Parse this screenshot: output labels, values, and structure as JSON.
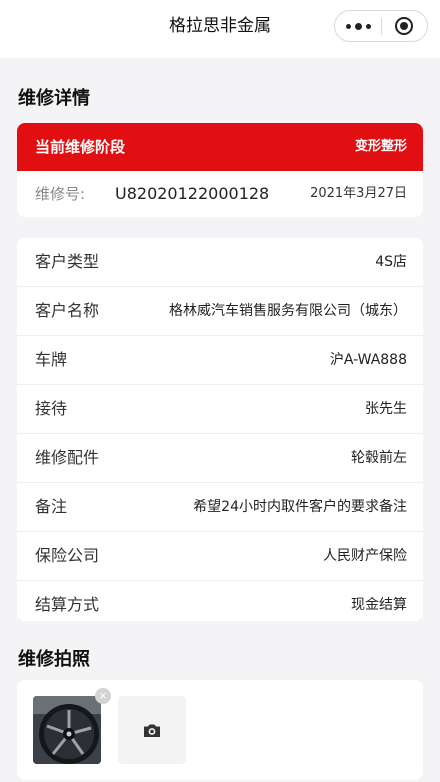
{
  "header": {
    "title": "格拉思非金属"
  },
  "repair_details": {
    "section_title": "维修详情",
    "stage_label": "当前维修阶段",
    "stage_value": "变形整形",
    "order_label": "维修号:",
    "order_number": "U82020122000128",
    "order_date": "2021年3月27日"
  },
  "info_rows": [
    {
      "key": "客户类型",
      "value": "4S店"
    },
    {
      "key": "客户名称",
      "value": "格林威汽车销售服务有限公司（城东）"
    },
    {
      "key": "车牌",
      "value": "沪A-WA888"
    },
    {
      "key": "接待",
      "value": "张先生"
    },
    {
      "key": "维修配件",
      "value": "轮毂前左"
    },
    {
      "key": "备注",
      "value": "希望24小时内取件客户的要求备注"
    },
    {
      "key": "保险公司",
      "value": "人民财产保险"
    },
    {
      "key": "结算方式",
      "value": "现金结算"
    }
  ],
  "photos": {
    "section_title": "维修拍照",
    "delete_symbol": "×",
    "icons": {
      "camera": "camera-icon",
      "delete": "close-icon"
    }
  },
  "colors": {
    "accent": "#e10e12",
    "background": "#f4f4f6"
  }
}
